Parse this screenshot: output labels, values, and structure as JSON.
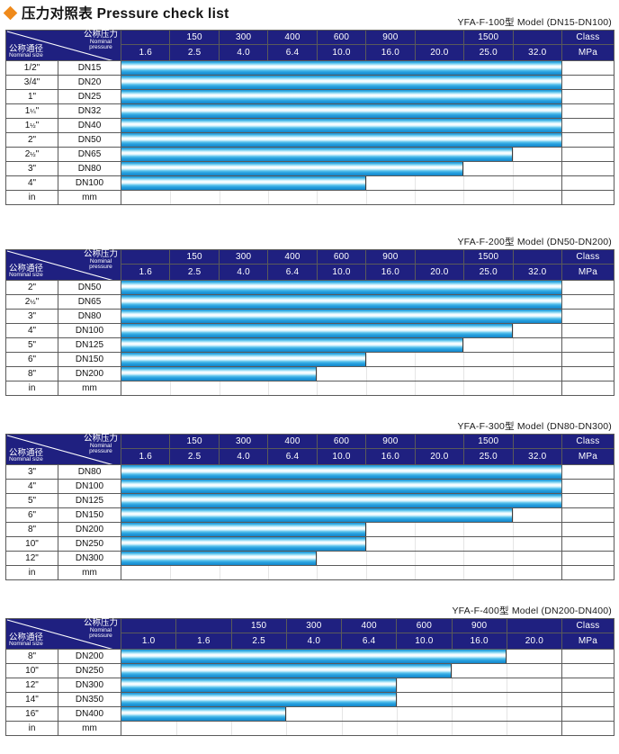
{
  "page": {
    "title_cn": "压力对照表",
    "title_en": "Pressure check list",
    "accent_color": "#ef8a1b",
    "header_color": "#1f2080",
    "bar_color": "#2ea6e0"
  },
  "corner": {
    "nominal_pressure_cn": "公称压力",
    "nominal_pressure_en_1": "Nominal",
    "nominal_pressure_en_2": "pressure",
    "nominal_size_cn": "公称通径",
    "nominal_size_en": "Nominal size"
  },
  "units": {
    "size_unit": "in",
    "dn_unit": "mm"
  },
  "class_header": "Class",
  "mpa_header": "MPa",
  "chart_data": {
    "type": "bar",
    "title": "压力对照表 Pressure check list",
    "xlabel": "Nominal pressure (MPa) / Class",
    "ylabel": "Nominal size (in / mm)",
    "tables": [
      {
        "model": "YFA-F-100型  Model (DN15-DN100)",
        "model_code": "YFA-F-100",
        "model_range": "DN15-DN100",
        "class_row": [
          "",
          "150",
          "300",
          "400",
          "600",
          "900",
          "",
          "1500",
          "",
          "Class"
        ],
        "mpa_row": [
          "1.6",
          "2.5",
          "4.0",
          "6.4",
          "10.0",
          "16.0",
          "20.0",
          "25.0",
          "32.0",
          "MPa"
        ],
        "pressures": [
          1.6,
          2.5,
          4.0,
          6.4,
          10.0,
          16.0,
          20.0,
          25.0,
          32.0
        ],
        "rows": [
          {
            "size_in": "1/2\"",
            "dn": "DN15",
            "max_mpa": 32.0,
            "cols": 9
          },
          {
            "size_in": "3/4\"",
            "dn": "DN20",
            "max_mpa": 32.0,
            "cols": 9
          },
          {
            "size_in": "1\"",
            "dn": "DN25",
            "max_mpa": 32.0,
            "cols": 9
          },
          {
            "size_in": "1¼\"",
            "dn": "DN32",
            "max_mpa": 32.0,
            "cols": 9
          },
          {
            "size_in": "1½\"",
            "dn": "DN40",
            "max_mpa": 32.0,
            "cols": 9
          },
          {
            "size_in": "2\"",
            "dn": "DN50",
            "max_mpa": 32.0,
            "cols": 9
          },
          {
            "size_in": "2½\"",
            "dn": "DN65",
            "max_mpa": 25.0,
            "cols": 8
          },
          {
            "size_in": "3\"",
            "dn": "DN80",
            "max_mpa": 20.0,
            "cols": 7
          },
          {
            "size_in": "4\"",
            "dn": "DN100",
            "max_mpa": 10.0,
            "cols": 5
          }
        ]
      },
      {
        "model": "YFA-F-200型  Model (DN50-DN200)",
        "model_code": "YFA-F-200",
        "model_range": "DN50-DN200",
        "class_row": [
          "",
          "150",
          "300",
          "400",
          "600",
          "900",
          "",
          "1500",
          "",
          "Class"
        ],
        "mpa_row": [
          "1.6",
          "2.5",
          "4.0",
          "6.4",
          "10.0",
          "16.0",
          "20.0",
          "25.0",
          "32.0",
          "MPa"
        ],
        "pressures": [
          1.6,
          2.5,
          4.0,
          6.4,
          10.0,
          16.0,
          20.0,
          25.0,
          32.0
        ],
        "rows": [
          {
            "size_in": "2\"",
            "dn": "DN50",
            "max_mpa": 32.0,
            "cols": 9
          },
          {
            "size_in": "2½\"",
            "dn": "DN65",
            "max_mpa": 32.0,
            "cols": 9
          },
          {
            "size_in": "3\"",
            "dn": "DN80",
            "max_mpa": 32.0,
            "cols": 9
          },
          {
            "size_in": "4\"",
            "dn": "DN100",
            "max_mpa": 25.0,
            "cols": 8
          },
          {
            "size_in": "5\"",
            "dn": "DN125",
            "max_mpa": 20.0,
            "cols": 7
          },
          {
            "size_in": "6\"",
            "dn": "DN150",
            "max_mpa": 10.0,
            "cols": 5
          },
          {
            "size_in": "8\"",
            "dn": "DN200",
            "max_mpa": 6.4,
            "cols": 4
          }
        ]
      },
      {
        "model": "YFA-F-300型  Model (DN80-DN300)",
        "model_code": "YFA-F-300",
        "model_range": "DN80-DN300",
        "class_row": [
          "",
          "150",
          "300",
          "400",
          "600",
          "900",
          "",
          "1500",
          "",
          "Class"
        ],
        "mpa_row": [
          "1.6",
          "2.5",
          "4.0",
          "6.4",
          "10.0",
          "16.0",
          "20.0",
          "25.0",
          "32.0",
          "MPa"
        ],
        "pressures": [
          1.6,
          2.5,
          4.0,
          6.4,
          10.0,
          16.0,
          20.0,
          25.0,
          32.0
        ],
        "rows": [
          {
            "size_in": "3\"",
            "dn": "DN80",
            "max_mpa": 32.0,
            "cols": 9
          },
          {
            "size_in": "4\"",
            "dn": "DN100",
            "max_mpa": 32.0,
            "cols": 9
          },
          {
            "size_in": "5\"",
            "dn": "DN125",
            "max_mpa": 32.0,
            "cols": 9
          },
          {
            "size_in": "6\"",
            "dn": "DN150",
            "max_mpa": 25.0,
            "cols": 8
          },
          {
            "size_in": "8\"",
            "dn": "DN200",
            "max_mpa": 10.0,
            "cols": 5
          },
          {
            "size_in": "10\"",
            "dn": "DN250",
            "max_mpa": 10.0,
            "cols": 5
          },
          {
            "size_in": "12\"",
            "dn": "DN300",
            "max_mpa": 6.4,
            "cols": 4
          }
        ]
      },
      {
        "model": "YFA-F-400型  Model (DN200-DN400)",
        "model_code": "YFA-F-400",
        "model_range": "DN200-DN400",
        "class_row": [
          "",
          "",
          "150",
          "300",
          "400",
          "600",
          "900",
          "",
          "Class"
        ],
        "mpa_row": [
          "1.0",
          "1.6",
          "2.5",
          "4.0",
          "6.4",
          "10.0",
          "16.0",
          "20.0",
          "MPa"
        ],
        "pressures": [
          1.0,
          1.6,
          2.5,
          4.0,
          6.4,
          10.0,
          16.0,
          20.0
        ],
        "rows": [
          {
            "size_in": "8\"",
            "dn": "DN200",
            "max_mpa": 16.0,
            "cols": 7
          },
          {
            "size_in": "10\"",
            "dn": "DN250",
            "max_mpa": 10.0,
            "cols": 6
          },
          {
            "size_in": "12\"",
            "dn": "DN300",
            "max_mpa": 6.4,
            "cols": 5
          },
          {
            "size_in": "14\"",
            "dn": "DN350",
            "max_mpa": 6.4,
            "cols": 5
          },
          {
            "size_in": "16\"",
            "dn": "DN400",
            "max_mpa": 2.5,
            "cols": 3
          }
        ]
      }
    ]
  }
}
